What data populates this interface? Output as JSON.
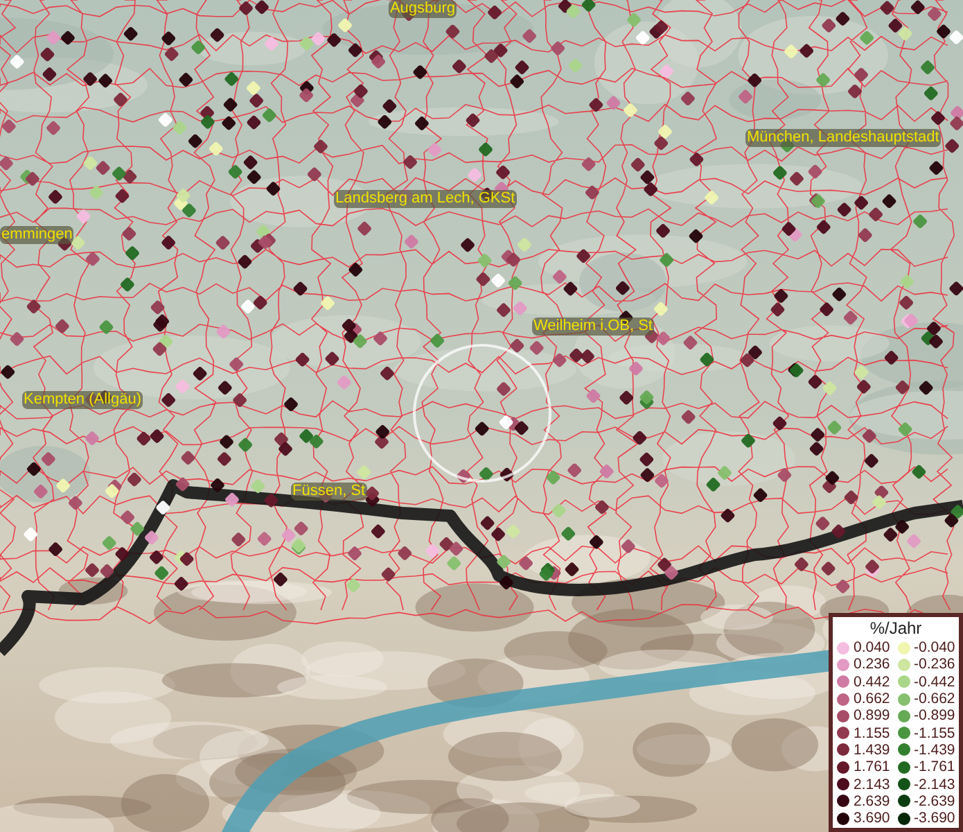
{
  "map": {
    "place_labels": [
      {
        "text": "Augsburg"
      },
      {
        "text": "München, Landeshauptstadt"
      },
      {
        "text": "Landsberg am Lech, GKSt"
      },
      {
        "text": "emmingen"
      },
      {
        "text": "Weilheim i.OB, St"
      },
      {
        "text": "Kempten (Allgäu)"
      },
      {
        "text": "Füssen, St"
      }
    ]
  },
  "legend": {
    "title": "%/Jahr",
    "positive": [
      {
        "value": "0.040",
        "color": "#f5bde0"
      },
      {
        "value": "0.236",
        "color": "#e39ac4"
      },
      {
        "value": "0.442",
        "color": "#cf7aa3"
      },
      {
        "value": "0.662",
        "color": "#bf6485"
      },
      {
        "value": "0.899",
        "color": "#a84d68"
      },
      {
        "value": "1.155",
        "color": "#923a50"
      },
      {
        "value": "1.439",
        "color": "#7d2a3c"
      },
      {
        "value": "1.761",
        "color": "#65182a"
      },
      {
        "value": "2.143",
        "color": "#4c0c1c"
      },
      {
        "value": "2.639",
        "color": "#360612"
      },
      {
        "value": "3.690",
        "color": "#22030a"
      }
    ],
    "negative": [
      {
        "value": "-0.040",
        "color": "#f0f5b0"
      },
      {
        "value": "-0.236",
        "color": "#cfe6a0"
      },
      {
        "value": "-0.442",
        "color": "#aad68a"
      },
      {
        "value": "-0.662",
        "color": "#86c06e"
      },
      {
        "value": "-0.899",
        "color": "#66aa55"
      },
      {
        "value": "-1.155",
        "color": "#4a9640"
      },
      {
        "value": "-1.439",
        "color": "#347f30"
      },
      {
        "value": "-1.761",
        "color": "#226a22"
      },
      {
        "value": "-2.143",
        "color": "#155418"
      },
      {
        "value": "-2.639",
        "color": "#0c3d10"
      },
      {
        "value": "-3.690",
        "color": "#072808"
      }
    ]
  }
}
